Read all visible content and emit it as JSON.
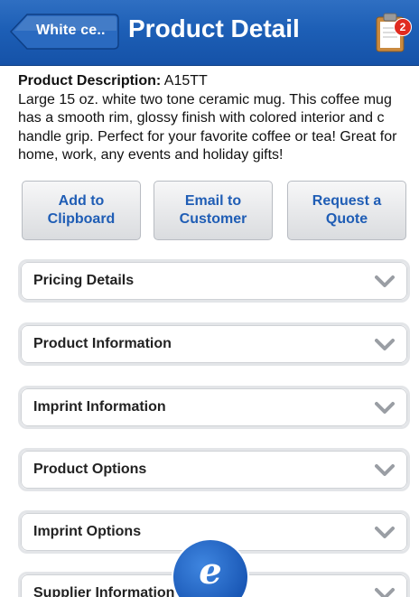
{
  "header": {
    "back_label": "White ce..",
    "title": "Product Detail",
    "badge_count": "2"
  },
  "description": {
    "label": "Product Description:",
    "code": "A15TT",
    "text": "Large 15 oz. white two tone ceramic mug. This coffee mug has a smooth rim, glossy finish with colored interior and c handle grip. Perfect for your favorite coffee or tea! Great for home, work, any events and holiday gifts!"
  },
  "actions": {
    "clipboard": "Add to Clipboard",
    "email": "Email to Customer",
    "quote": "Request a Quote"
  },
  "sections": [
    "Pricing Details",
    "Product Information",
    "Imprint Information",
    "Product Options",
    "Imprint Options",
    "Supplier Information"
  ],
  "fab_glyph": "e",
  "colors": {
    "header_blue": "#1d5fb6",
    "link_blue": "#1f5db5",
    "badge_red": "#e02b20"
  }
}
